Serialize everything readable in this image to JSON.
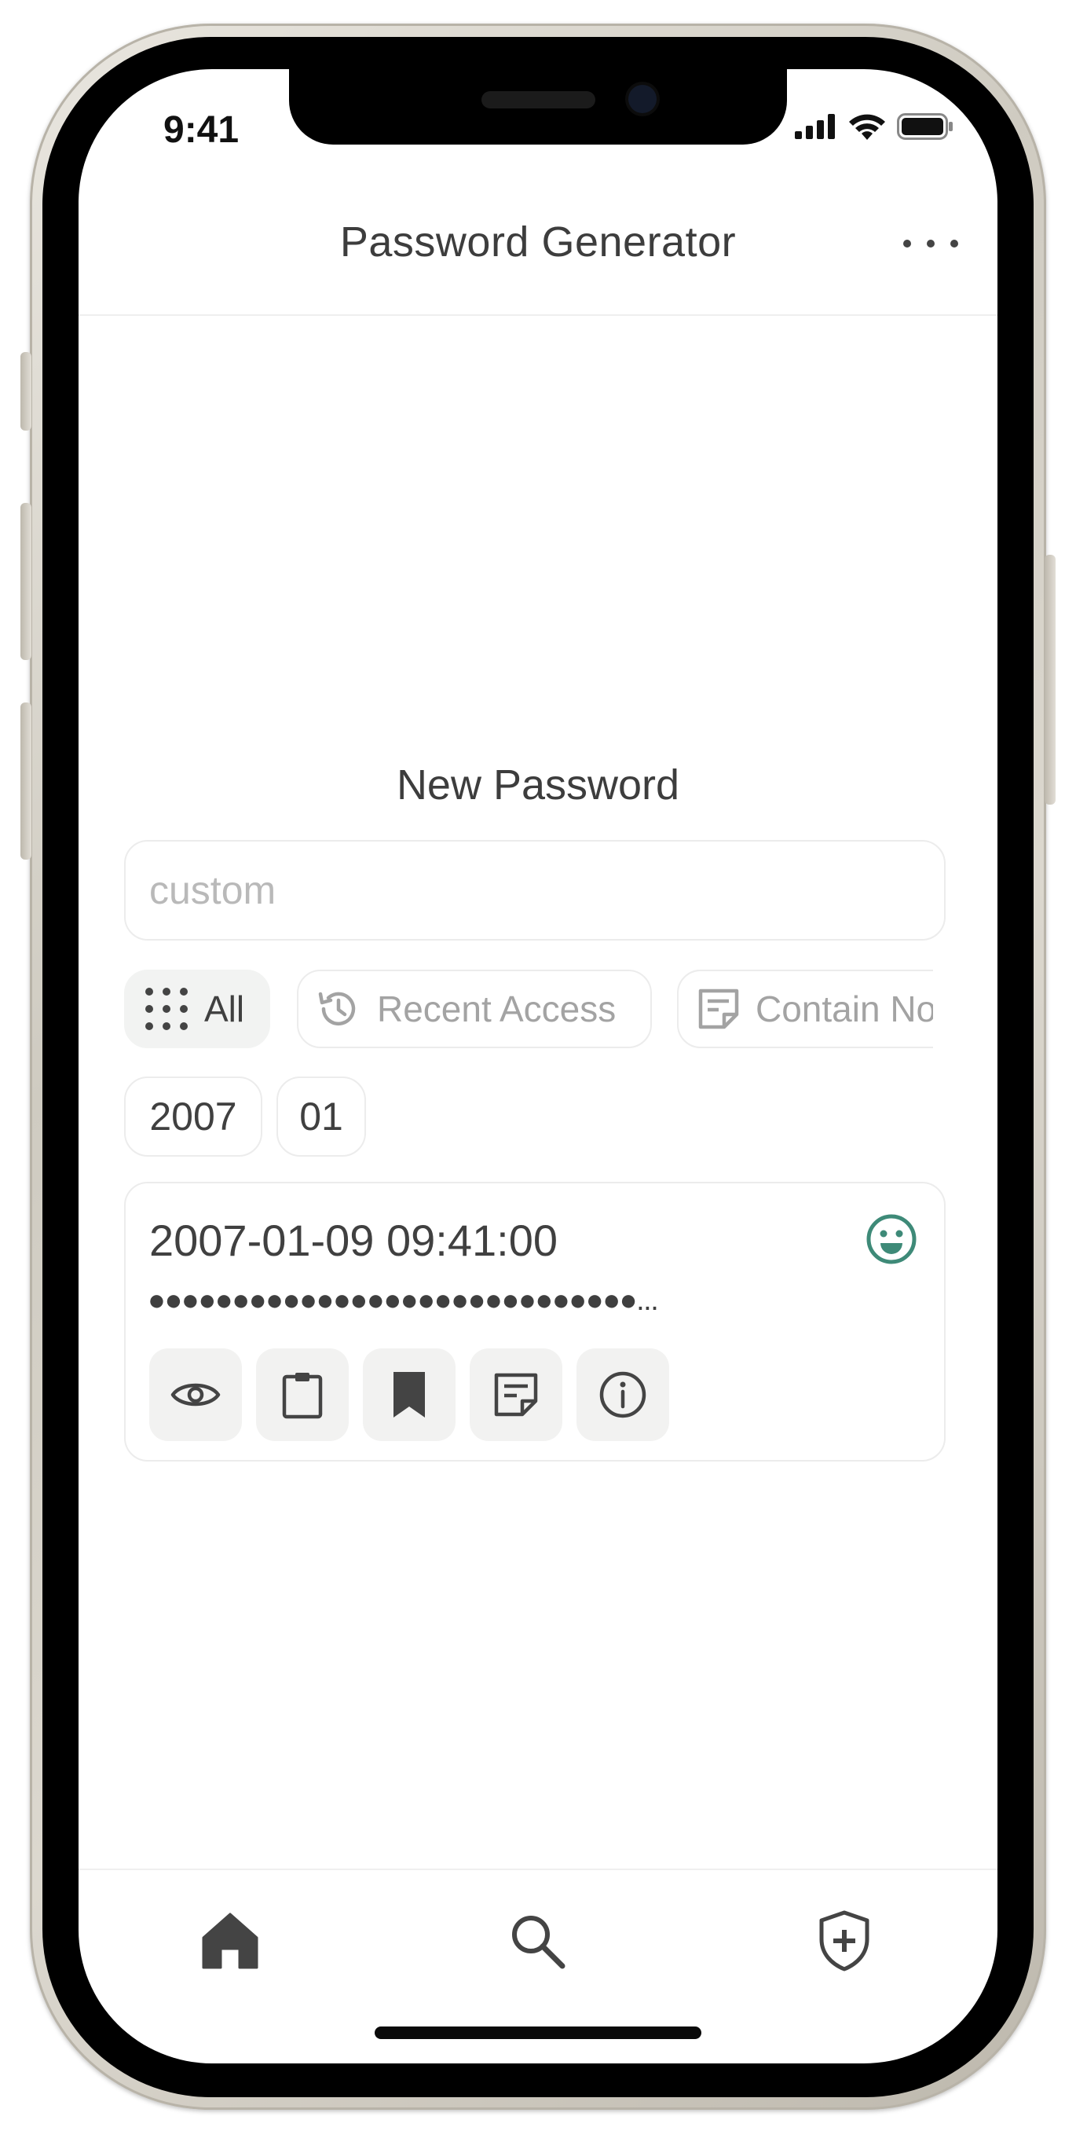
{
  "status_bar": {
    "time": "9:41"
  },
  "header": {
    "title": "Password Generator"
  },
  "main": {
    "section_title": "New Password",
    "search": {
      "placeholder": "custom",
      "value": ""
    },
    "filters": [
      {
        "label": "All",
        "icon": "grid-dots-icon",
        "active": true
      },
      {
        "label": "Recent Access",
        "icon": "history-icon",
        "active": false
      },
      {
        "label": "Contain No",
        "icon": "note-icon",
        "active": false
      }
    ],
    "tags": [
      "2007",
      "01"
    ],
    "entry": {
      "date": "2007-01-09 09:41:00",
      "masked_password": "●●●●●●●●●●●●●●●●●●●●●●●●●●●●●...",
      "status_icon": "smiley-icon",
      "actions": [
        "eye-icon",
        "clipboard-icon",
        "bookmark-icon",
        "note-icon",
        "info-icon"
      ]
    }
  },
  "tabbar": {
    "items": [
      "home-icon",
      "search-icon",
      "shield-plus-icon"
    ]
  },
  "colors": {
    "accent_green": "#3e8a78",
    "text": "#404040",
    "muted": "#a3a3a3"
  }
}
